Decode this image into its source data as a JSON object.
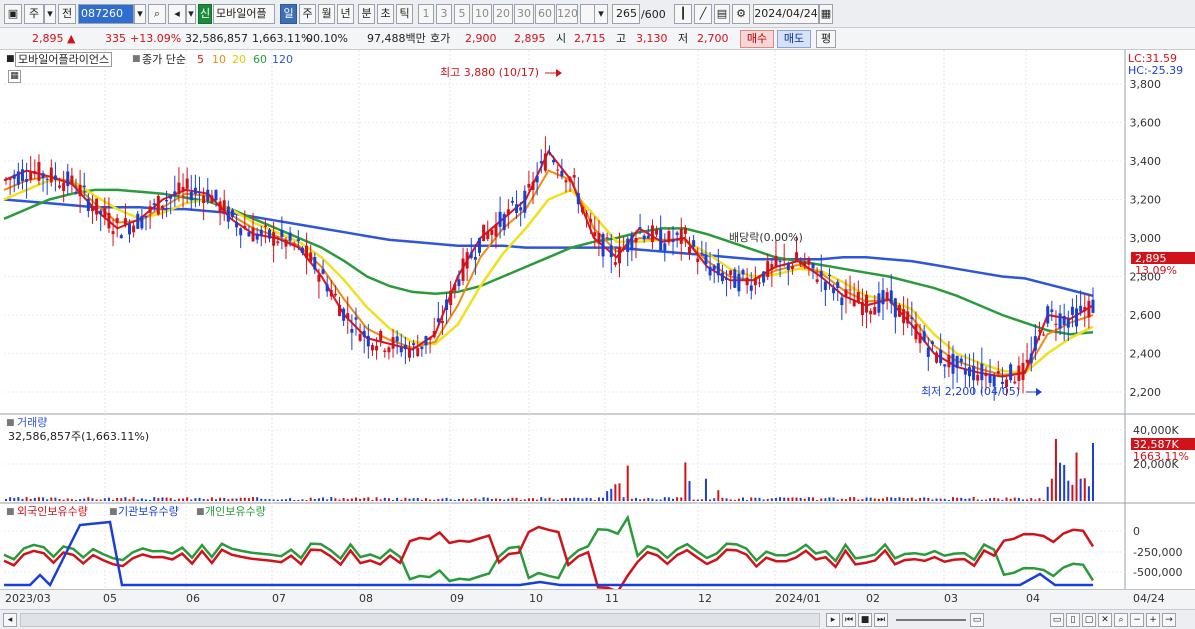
{
  "toolbar": {
    "type_label": "주",
    "prev_label": "전",
    "code": "087260",
    "new_label": "신",
    "stock_name": "모바일어플",
    "periods": [
      "일",
      "주",
      "월",
      "년",
      "분",
      "초",
      "틱"
    ],
    "intervals": [
      "1",
      "3",
      "5",
      "10",
      "20",
      "30",
      "60",
      "120"
    ],
    "count": "265",
    "count_max": "/600",
    "date": "2024/04/24"
  },
  "quote": {
    "price": "2,895",
    "arrow": "▲",
    "change": "335",
    "change_pct": "+13.09%",
    "volume": "32,586,857",
    "volume_ratio": "1,663.11%",
    "turnover": "00.10%",
    "amount": "97,488백만",
    "bid_label": "호가",
    "bid1": "2,900",
    "bid2": "2,895",
    "open_label": "시",
    "open": "2,715",
    "high_label": "고",
    "high": "3,130",
    "low_label": "저",
    "low": "2,700",
    "buy_label": "매수",
    "sell_label": "매도",
    "eval_label": "평"
  },
  "price_panel": {
    "stock_label": "모바일어플라이언스",
    "ma_label": "종가 단순",
    "ma_periods": [
      "5",
      "10",
      "20",
      "60",
      "120"
    ],
    "high_note": "최고 3,880 (10/17)",
    "low_note": "최저 2,200 (04/05)",
    "div_note": "배당락(0.00%)",
    "lc": "LC:31.59",
    "hc": "HC:-25.39",
    "price_tag": "2,895",
    "pct_tag": "13.09%",
    "y_ticks": [
      "3,800",
      "3,600",
      "3,400",
      "3,200",
      "3,000",
      "2,800",
      "2,600",
      "2,400",
      "2,200"
    ]
  },
  "volume_panel": {
    "title": "거래량",
    "value": "32,586,857주(1,663.11%)",
    "y_ticks": [
      "40,000K",
      "20,000K"
    ],
    "tag_value": "32,587K",
    "tag_pct": "1663.11%"
  },
  "holding_panel": {
    "foreign": "외국인보유수량",
    "institution": "기관보유수량",
    "individual": "개인보유수량",
    "y_ticks": [
      "0",
      "-250,000",
      "-500,000"
    ]
  },
  "x_labels": [
    "2023/03",
    "05",
    "06",
    "07",
    "08",
    "09",
    "10",
    "11",
    "12",
    "2024/01",
    "02",
    "03",
    "04",
    "04/24"
  ],
  "colors": {
    "up": "#d0131b",
    "down": "#1a3fd4",
    "ma5": "#e0141e",
    "ma10": "#f08a10",
    "ma20": "#f0e020",
    "ma60": "#2a9a3a",
    "ma120": "#2f55d8"
  },
  "chart_data": {
    "type": "line",
    "y_range": [
      2100,
      3900
    ],
    "series": [
      {
        "name": "5",
        "values": [
          3300,
          3350,
          3320,
          3280,
          3150,
          3050,
          3100,
          3200,
          3250,
          3230,
          3100,
          3020,
          3000,
          2950,
          2800,
          2600,
          2480,
          2450,
          2420,
          2500,
          2800,
          3000,
          3100,
          3200,
          3450,
          3300,
          3000,
          2900,
          3050,
          2980,
          3000,
          2850,
          2780,
          2780,
          2850,
          2880,
          2800,
          2700,
          2650,
          2680,
          2550,
          2400,
          2330,
          2300,
          2280,
          2300,
          2600,
          2580,
          2650
        ]
      },
      {
        "name": "10",
        "values": [
          3250,
          3300,
          3320,
          3290,
          3180,
          3080,
          3090,
          3160,
          3230,
          3220,
          3120,
          3050,
          3010,
          2960,
          2850,
          2680,
          2530,
          2470,
          2430,
          2460,
          2650,
          2900,
          3050,
          3150,
          3350,
          3300,
          3050,
          2930,
          3000,
          2990,
          2990,
          2880,
          2800,
          2780,
          2830,
          2860,
          2820,
          2730,
          2670,
          2680,
          2590,
          2440,
          2360,
          2320,
          2290,
          2300,
          2500,
          2560,
          2600
        ]
      },
      {
        "name": "20",
        "values": [
          3200,
          3250,
          3300,
          3300,
          3220,
          3150,
          3100,
          3130,
          3180,
          3200,
          3150,
          3080,
          3030,
          2980,
          2900,
          2780,
          2640,
          2530,
          2460,
          2450,
          2550,
          2750,
          2920,
          3050,
          3200,
          3250,
          3120,
          2980,
          2980,
          2990,
          2990,
          2920,
          2840,
          2800,
          2810,
          2840,
          2830,
          2770,
          2700,
          2680,
          2630,
          2500,
          2400,
          2350,
          2310,
          2300,
          2400,
          2480,
          2540
        ]
      },
      {
        "name": "60",
        "values": [
          3100,
          3150,
          3200,
          3230,
          3250,
          3250,
          3240,
          3230,
          3210,
          3190,
          3150,
          3100,
          3050,
          3000,
          2950,
          2880,
          2800,
          2750,
          2720,
          2710,
          2720,
          2750,
          2800,
          2850,
          2900,
          2950,
          2980,
          3000,
          3030,
          3050,
          3050,
          3020,
          2980,
          2940,
          2900,
          2880,
          2860,
          2840,
          2820,
          2800,
          2770,
          2740,
          2700,
          2650,
          2600,
          2560,
          2520,
          2500,
          2510
        ]
      },
      {
        "name": "120",
        "values": [
          3200,
          3190,
          3180,
          3170,
          3160,
          3160,
          3160,
          3150,
          3150,
          3140,
          3130,
          3110,
          3090,
          3070,
          3050,
          3030,
          3010,
          2990,
          2980,
          2970,
          2960,
          2960,
          2960,
          2950,
          2950,
          2950,
          2950,
          2950,
          2940,
          2930,
          2920,
          2910,
          2900,
          2890,
          2890,
          2890,
          2890,
          2900,
          2900,
          2890,
          2880,
          2860,
          2840,
          2820,
          2800,
          2790,
          2760,
          2730,
          2700
        ]
      }
    ]
  }
}
